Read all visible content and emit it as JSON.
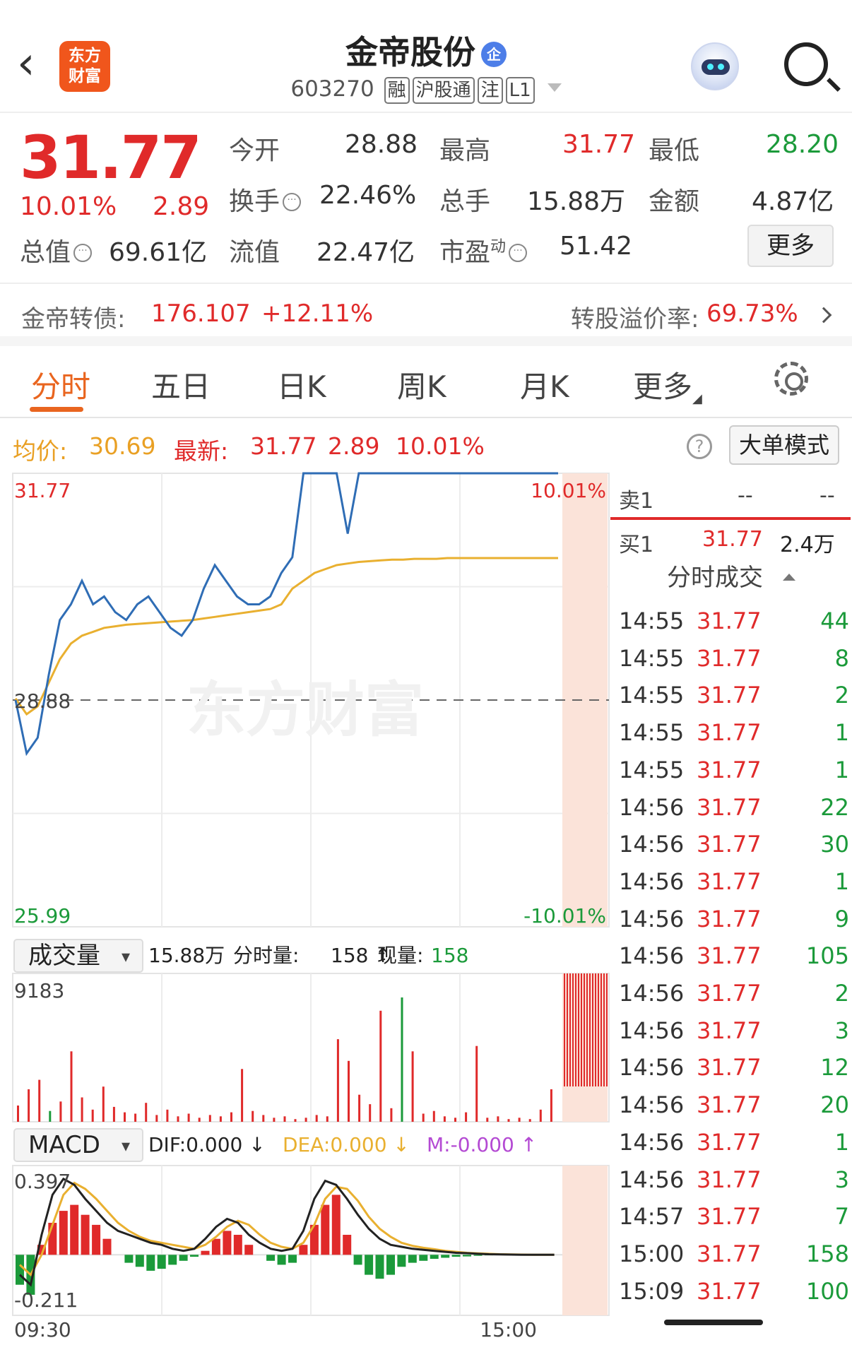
{
  "header": {
    "back_icon": "back-arrow",
    "logo_line1": "东方",
    "logo_line2": "财富",
    "stock_name": "金帝股份",
    "qi_badge": "企",
    "code": "603270",
    "tags": [
      "融",
      "沪股通",
      "注",
      "L1"
    ]
  },
  "quote": {
    "price": "31.77",
    "pct": "10.01%",
    "chg": "2.89",
    "items": [
      {
        "label": "今开",
        "value": "28.88",
        "color": "#333333"
      },
      {
        "label": "最高",
        "value": "31.77",
        "color": "#e02a2a"
      },
      {
        "label": "最低",
        "value": "28.20",
        "color": "#1b9a3a"
      },
      {
        "label": "换手",
        "value": "22.46%",
        "color": "#333333"
      },
      {
        "label": "总手",
        "value": "15.88万",
        "color": "#333333"
      },
      {
        "label": "金额",
        "value": "4.87亿",
        "color": "#333333"
      },
      {
        "label": "总值",
        "value": "69.61亿",
        "color": "#333333"
      },
      {
        "label": "流值",
        "value": "22.47亿",
        "color": "#333333"
      },
      {
        "label": "市盈",
        "value": "51.42",
        "color": "#333333"
      }
    ],
    "pe_sup": "动",
    "more": "更多"
  },
  "bond": {
    "label": "金帝转债:",
    "price": "176.107",
    "pct": "+12.11%",
    "premium_label": "转股溢价率:",
    "premium": "69.73%"
  },
  "tabs": [
    "分时",
    "五日",
    "日K",
    "周K",
    "月K",
    "更多"
  ],
  "info": {
    "avg_label": "均价:",
    "avg": "30.69",
    "latest_label": "最新:",
    "latest": "31.77",
    "chg": "2.89",
    "pct": "10.01%",
    "help": "?",
    "big_order": "大单模式"
  },
  "chart_data": [
    {
      "type": "line",
      "title": "分时",
      "x_start": "09:30",
      "x_end": "15:00",
      "ylim": [
        25.99,
        31.77
      ],
      "yticks": [
        "31.77",
        "28.88",
        "25.99"
      ],
      "pct_ticks": [
        "10.01%",
        "-10.01%"
      ],
      "series": [
        {
          "name": "最新",
          "color": "#2f6db5",
          "values": [
            28.88,
            28.2,
            28.4,
            29.2,
            29.9,
            30.1,
            30.4,
            30.1,
            30.2,
            30.0,
            29.9,
            30.1,
            30.2,
            30.0,
            29.8,
            29.7,
            29.9,
            30.3,
            30.6,
            30.4,
            30.2,
            30.1,
            30.1,
            30.2,
            30.5,
            30.7,
            31.77,
            31.77,
            31.77,
            31.77,
            31.0,
            31.77,
            31.77,
            31.77,
            31.77,
            31.77,
            31.77,
            31.77,
            31.77,
            31.77,
            31.77,
            31.77,
            31.77,
            31.77,
            31.77,
            31.77,
            31.77,
            31.77,
            31.77,
            31.77
          ]
        },
        {
          "name": "均价",
          "color": "#e9b030",
          "values": [
            28.9,
            28.7,
            28.8,
            29.1,
            29.4,
            29.6,
            29.7,
            29.75,
            29.8,
            29.82,
            29.84,
            29.85,
            29.86,
            29.87,
            29.88,
            29.89,
            29.9,
            29.92,
            29.94,
            29.96,
            29.98,
            30.0,
            30.02,
            30.04,
            30.1,
            30.3,
            30.4,
            30.5,
            30.55,
            30.6,
            30.62,
            30.64,
            30.65,
            30.66,
            30.67,
            30.67,
            30.68,
            30.68,
            30.68,
            30.69,
            30.69,
            30.69,
            30.69,
            30.69,
            30.69,
            30.69,
            30.69,
            30.69,
            30.69,
            30.69
          ]
        }
      ]
    },
    {
      "type": "bar",
      "title": "成交量",
      "total": "15.88万",
      "period_vol_label": "分时量:",
      "period_vol": "158",
      "now_vol_label": "现量:",
      "now_vol": "158",
      "ymax": "9183",
      "values": [
        1200,
        2400,
        3100,
        800,
        1500,
        5200,
        1800,
        900,
        2600,
        1100,
        700,
        600,
        1400,
        500,
        900,
        400,
        600,
        300,
        500,
        400,
        700,
        3900,
        800,
        500,
        300,
        400,
        200,
        300,
        500,
        400,
        6100,
        4500,
        2000,
        1300,
        8200,
        1000,
        9183,
        5200,
        600,
        800,
        400,
        300,
        700,
        5600,
        300,
        400,
        200,
        300,
        200,
        900,
        2400
      ],
      "up": [
        true,
        true,
        true,
        false,
        true,
        true,
        true,
        true,
        true,
        true,
        true,
        true,
        true,
        true,
        true,
        true,
        true,
        true,
        true,
        true,
        true,
        true,
        true,
        true,
        true,
        true,
        true,
        true,
        true,
        true,
        true,
        true,
        true,
        true,
        true,
        true,
        false,
        true,
        true,
        true,
        true,
        true,
        true,
        true,
        true,
        true,
        true,
        true,
        true,
        true,
        true
      ]
    },
    {
      "type": "bar",
      "title": "MACD",
      "dif_label": "DIF:",
      "dif": "0.000",
      "dea_label": "DEA:",
      "dea": "0.000",
      "m_label": "M:",
      "m": "-0.000",
      "ylim": [
        -0.211,
        0.397
      ],
      "bars": [
        -0.15,
        -0.2,
        0.05,
        0.16,
        0.22,
        0.25,
        0.2,
        0.15,
        0.08,
        0.0,
        -0.04,
        -0.06,
        -0.08,
        -0.07,
        -0.05,
        -0.03,
        -0.01,
        0.02,
        0.08,
        0.12,
        0.1,
        0.05,
        0.0,
        -0.03,
        -0.05,
        -0.04,
        0.05,
        0.15,
        0.25,
        0.3,
        0.1,
        -0.05,
        -0.1,
        -0.12,
        -0.1,
        -0.06,
        -0.04,
        -0.03,
        -0.02,
        -0.015,
        -0.01,
        -0.008,
        -0.005,
        -0.003,
        -0.002,
        -0.001,
        0,
        0,
        0,
        0
      ],
      "dif_line": [
        -0.1,
        -0.15,
        0.1,
        0.3,
        0.38,
        0.35,
        0.28,
        0.22,
        0.16,
        0.12,
        0.1,
        0.08,
        0.06,
        0.05,
        0.03,
        0.02,
        0.03,
        0.08,
        0.14,
        0.18,
        0.16,
        0.1,
        0.06,
        0.03,
        0.02,
        0.03,
        0.12,
        0.28,
        0.37,
        0.35,
        0.28,
        0.2,
        0.13,
        0.08,
        0.05,
        0.04,
        0.03,
        0.025,
        0.02,
        0.015,
        0.01,
        0.008,
        0.005,
        0.003,
        0.002,
        0.001,
        0,
        0,
        0,
        0
      ],
      "dea_line": [
        -0.05,
        -0.1,
        0.0,
        0.15,
        0.3,
        0.36,
        0.33,
        0.28,
        0.22,
        0.16,
        0.12,
        0.09,
        0.07,
        0.06,
        0.05,
        0.04,
        0.03,
        0.05,
        0.09,
        0.14,
        0.17,
        0.15,
        0.1,
        0.06,
        0.04,
        0.03,
        0.06,
        0.15,
        0.28,
        0.34,
        0.33,
        0.27,
        0.19,
        0.13,
        0.09,
        0.06,
        0.045,
        0.035,
        0.028,
        0.02,
        0.015,
        0.01,
        0.007,
        0.005,
        0.003,
        0.002,
        0.001,
        0,
        0,
        0
      ]
    }
  ],
  "orderbook": {
    "sell_label": "卖1",
    "sell_price": "--",
    "sell_vol": "--",
    "buy_label": "买1",
    "buy_price": "31.77",
    "buy_vol": "2.4万"
  },
  "trades_title": "分时成交",
  "trades": [
    {
      "t": "14:55",
      "p": "31.77",
      "v": "44"
    },
    {
      "t": "14:55",
      "p": "31.77",
      "v": "8"
    },
    {
      "t": "14:55",
      "p": "31.77",
      "v": "2"
    },
    {
      "t": "14:55",
      "p": "31.77",
      "v": "1"
    },
    {
      "t": "14:55",
      "p": "31.77",
      "v": "1"
    },
    {
      "t": "14:56",
      "p": "31.77",
      "v": "22"
    },
    {
      "t": "14:56",
      "p": "31.77",
      "v": "30"
    },
    {
      "t": "14:56",
      "p": "31.77",
      "v": "1"
    },
    {
      "t": "14:56",
      "p": "31.77",
      "v": "9"
    },
    {
      "t": "14:56",
      "p": "31.77",
      "v": "105"
    },
    {
      "t": "14:56",
      "p": "31.77",
      "v": "2"
    },
    {
      "t": "14:56",
      "p": "31.77",
      "v": "3"
    },
    {
      "t": "14:56",
      "p": "31.77",
      "v": "12"
    },
    {
      "t": "14:56",
      "p": "31.77",
      "v": "20"
    },
    {
      "t": "14:56",
      "p": "31.77",
      "v": "1"
    },
    {
      "t": "14:56",
      "p": "31.77",
      "v": "3"
    },
    {
      "t": "14:57",
      "p": "31.77",
      "v": "7"
    },
    {
      "t": "15:00",
      "p": "31.77",
      "v": "158"
    },
    {
      "t": "15:09",
      "p": "31.77",
      "v": "100"
    }
  ],
  "watermark": "东方财富",
  "colors": {
    "up": "#e02a2a",
    "down": "#1b9a3a",
    "accent": "#e9651f",
    "price_line": "#2f6db5",
    "avg_line": "#e9b030"
  }
}
